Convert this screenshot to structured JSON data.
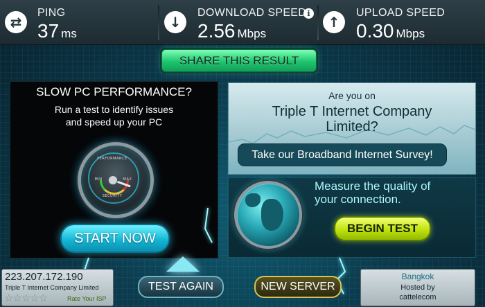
{
  "stats": {
    "ping": {
      "label": "PING",
      "value": "37",
      "unit": "ms",
      "icon": "ping-arrows-icon"
    },
    "download": {
      "label": "DOWNLOAD SPEED",
      "value": "2.56",
      "unit": "Mbps",
      "icon": "download-arrow-icon",
      "info": "i"
    },
    "upload": {
      "label": "UPLOAD SPEED",
      "value": "0.30",
      "unit": "Mbps",
      "icon": "upload-arrow-icon"
    }
  },
  "share": {
    "label": "SHARE THIS RESULT"
  },
  "ad_left": {
    "title": "SLOW PC PERFORMANCE?",
    "line1": "Run a test to identify issues",
    "line2": "and speed up your PC",
    "gauge_top": "PERFORMANCE",
    "gauge_min": "MIN",
    "gauge_max": "MAX",
    "gauge_bottom": "SECURITY",
    "button": "START NOW"
  },
  "survey": {
    "question": "Are you on",
    "isp_line1": "Triple T Internet Company",
    "isp_line2": "Limited?",
    "button": "Take our Broadband Internet Survey!"
  },
  "measure": {
    "line1": "Measure the quality of",
    "line2": "your connection.",
    "button": "BEGIN TEST"
  },
  "bottom": {
    "ip": "223.207.172.190",
    "isp": "Triple T Internet Company Limited",
    "stars": "☆☆☆☆☆",
    "rate": "Rate Your ISP",
    "test_again": "TEST AGAIN",
    "new_server": "NEW SERVER",
    "city": "Bangkok",
    "hosted_by": "Hosted by",
    "host": "cattelecom"
  },
  "colors": {
    "share_green": "#1fc46d",
    "start_cyan": "#15b7d6",
    "begin_yellow": "#bfe30f",
    "stats_bg": "#2e3f47"
  }
}
